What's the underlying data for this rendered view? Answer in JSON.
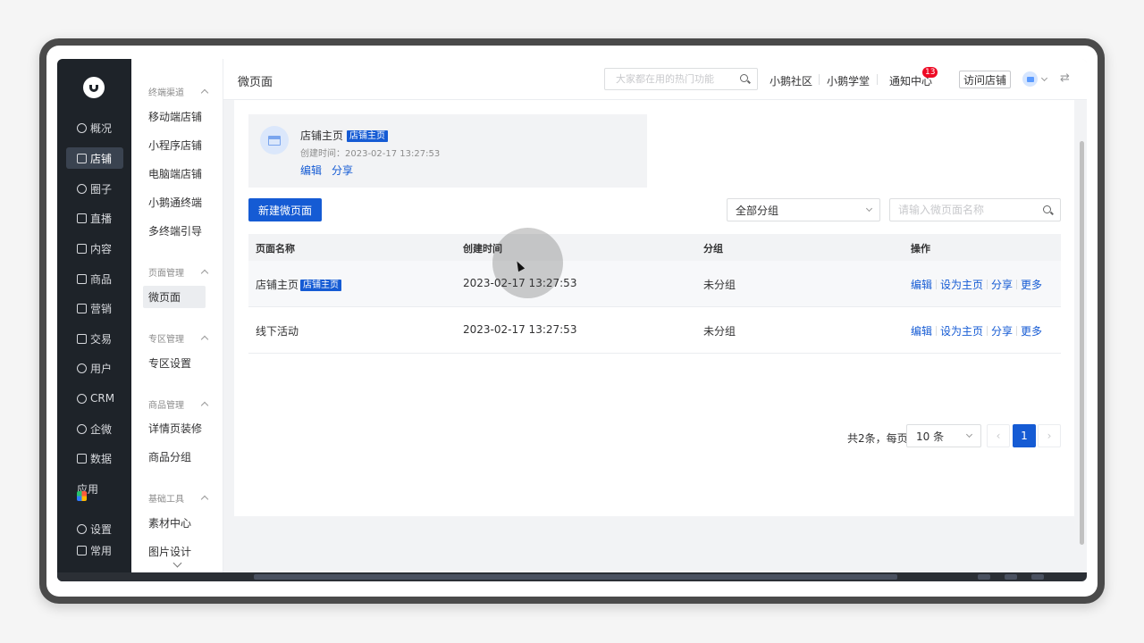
{
  "nav": {
    "items": [
      {
        "label": "概况",
        "icon": "dashboard-icon"
      },
      {
        "label": "店铺",
        "icon": "store-icon"
      },
      {
        "label": "圈子",
        "icon": "community-icon"
      },
      {
        "label": "直播",
        "icon": "live-icon"
      },
      {
        "label": "内容",
        "icon": "content-icon"
      },
      {
        "label": "商品",
        "icon": "goods-icon"
      },
      {
        "label": "营销",
        "icon": "megaphone-icon"
      },
      {
        "label": "交易",
        "icon": "trade-icon"
      },
      {
        "label": "用户",
        "icon": "user-icon"
      },
      {
        "label": "CRM",
        "icon": "crm-icon"
      },
      {
        "label": "企微",
        "icon": "wecom-icon"
      },
      {
        "label": "数据",
        "icon": "data-icon"
      },
      {
        "label": "应用",
        "icon": "apps-icon"
      },
      {
        "label": "设置",
        "icon": "gear-icon"
      },
      {
        "label": "常用",
        "icon": "list-icon"
      }
    ],
    "active": "店铺"
  },
  "subnav": {
    "groups": [
      {
        "title": "终端渠道",
        "items": [
          "移动端店铺",
          "小程序店铺",
          "电脑端店铺",
          "小鹅通终端",
          "多终端引导"
        ]
      },
      {
        "title": "页面管理",
        "items": [
          "微页面"
        ]
      },
      {
        "title": "专区管理",
        "items": [
          "专区设置"
        ]
      },
      {
        "title": "商品管理",
        "items": [
          "详情页装修",
          "商品分组"
        ]
      },
      {
        "title": "基础工具",
        "items": [
          "素材中心",
          "图片设计"
        ]
      }
    ],
    "active": "微页面"
  },
  "header": {
    "title": "微页面",
    "search_placeholder": "大家都在用的热门功能",
    "links": [
      "小鹅社区",
      "小鹅学堂",
      "通知中心"
    ],
    "notification_count": "13",
    "visit_store": "访问店铺"
  },
  "home_card": {
    "title": "店铺主页",
    "tag": "店铺主页",
    "created": "创建时间：2023-02-17 13:27:53",
    "actions": [
      "编辑",
      "分享"
    ]
  },
  "toolbar": {
    "new_page": "新建微页面",
    "group_select": "全部分组",
    "search_placeholder": "请输入微页面名称"
  },
  "table": {
    "headers": [
      "页面名称",
      "创建时间",
      "分组",
      "操作"
    ],
    "rows": [
      {
        "name": "店铺主页",
        "tag": "店铺主页",
        "created": "2023-02-17 13:27:53",
        "group": "未分组",
        "actions": [
          "编辑",
          "设为主页",
          "分享",
          "更多"
        ]
      },
      {
        "name": "线下活动",
        "tag": "",
        "created": "2023-02-17 13:27:53",
        "group": "未分组",
        "actions": [
          "编辑",
          "设为主页",
          "分享",
          "更多"
        ]
      }
    ]
  },
  "pagination": {
    "summary": "共2条，每页",
    "page_size": "10 条",
    "current_page": "1"
  },
  "colors": {
    "primary": "#155bd4",
    "sidebar_bg": "#1e2329",
    "badge": "#ee0a24"
  }
}
